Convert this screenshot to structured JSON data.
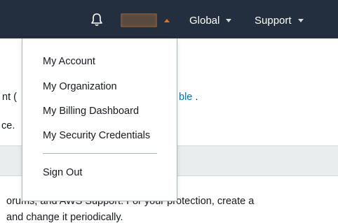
{
  "colors": {
    "topbar_bg": "#232f3e",
    "accent": "#ec7211",
    "link": "#0073bb",
    "band_bg": "#eaeded"
  },
  "topbar": {
    "bell_icon": "bell-icon",
    "account_caret_icon": "caret-up-icon",
    "nav": [
      {
        "label": "Global",
        "icon": "caret-down-icon"
      },
      {
        "label": "Support",
        "icon": "caret-down-icon"
      }
    ]
  },
  "account_menu": {
    "items": [
      "My Account",
      "My Organization",
      "My Billing Dashboard",
      "My Security Credentials",
      "Sign Out"
    ]
  },
  "page": {
    "line1_prefix": "nt (",
    "line1_link": "ble",
    "line1_suffix": " .",
    "line2": "ce.",
    "line3": "orums, and AWS Support. For your protection, create a",
    "line4": "and change it periodically."
  }
}
